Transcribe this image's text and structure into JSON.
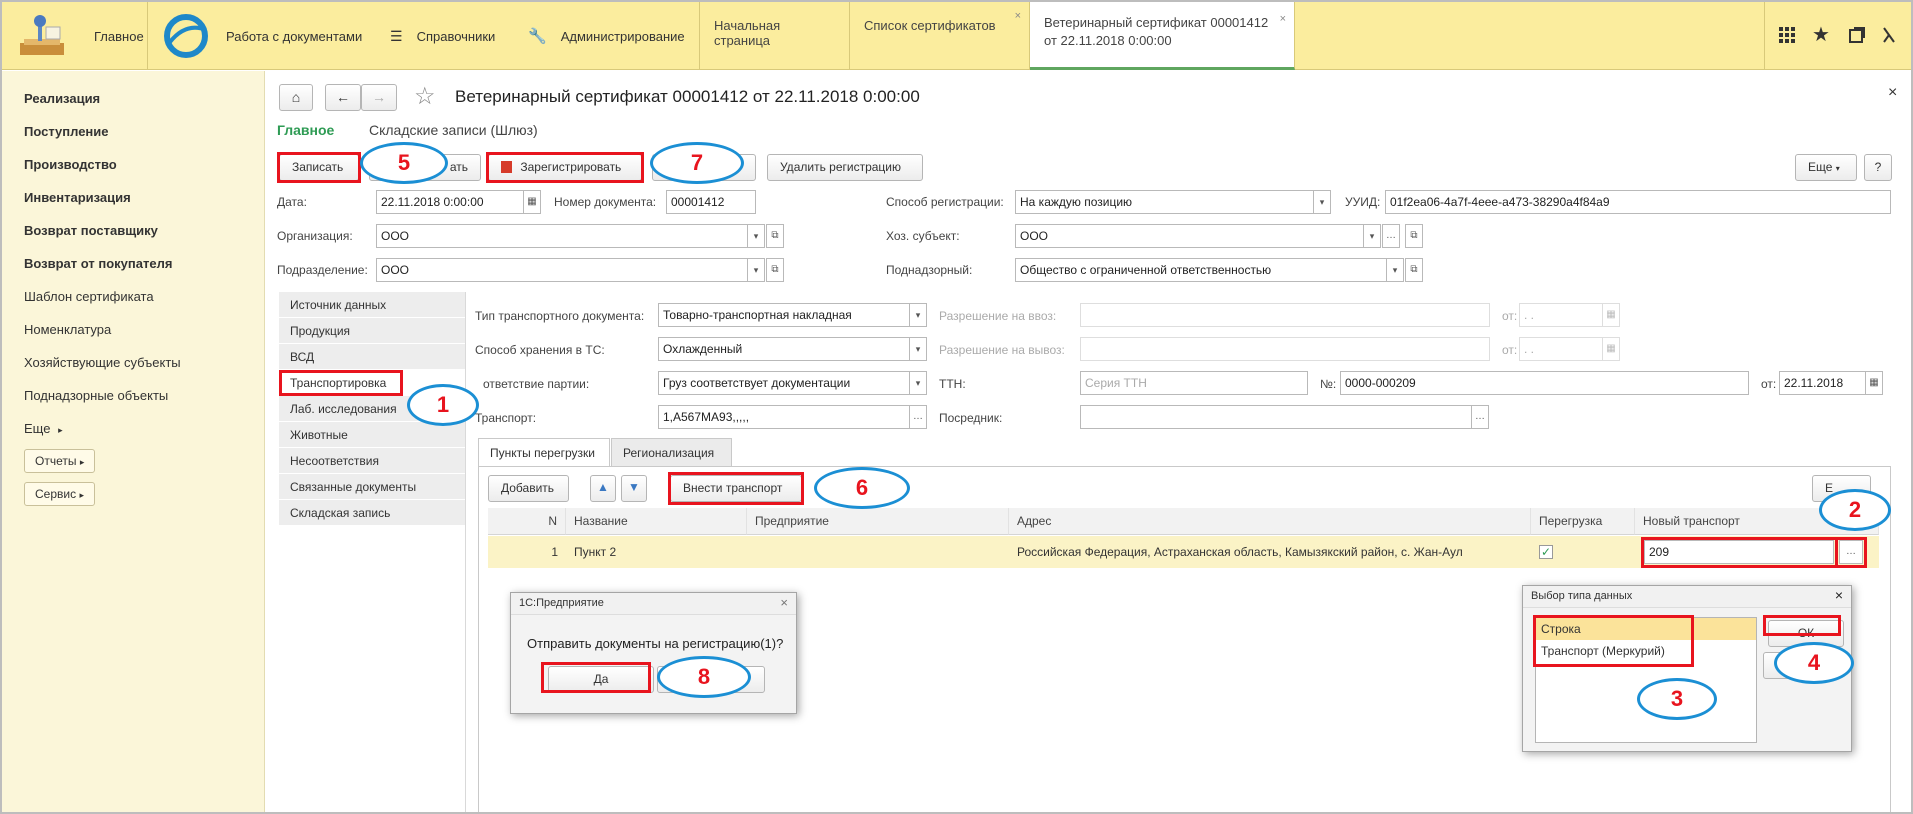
{
  "topbar": {
    "home": "Главное",
    "nav": [
      "Работа с документами",
      "Справочники",
      "Администрирование"
    ],
    "tabs": [
      "Начальная страница",
      "Список сертификатов",
      "Ветеринарный сертификат 00001412 от 22.11.2018 0:00:00"
    ],
    "tab_close": "×"
  },
  "sidebar": {
    "bold_items": [
      "Реализация",
      "Поступление",
      "Производство",
      "Инвентаризация",
      "Возврат поставщику",
      "Возврат от покупателя"
    ],
    "items": [
      "Шаблон сертификата",
      "Номенклатура",
      "Хозяйствующие субъекты",
      "Поднадзорные объекты"
    ],
    "more": "Еще",
    "pills": [
      "Отчеты",
      "Сервис"
    ]
  },
  "header": {
    "title": "Ветеринарный сертификат 00001412 от 22.11.2018 0:00:00",
    "close": "×"
  },
  "sections": {
    "main": "Главное",
    "warehouse": "Складские записи (Шлюз)"
  },
  "toolbar": {
    "save": "Записать",
    "post_partial": "ать",
    "register": "Зарегистрировать",
    "delete_reg": "Удалить регистрацию",
    "more": "Еще",
    "help": "?"
  },
  "form": {
    "date_label": "Дата:",
    "date_value": "22.11.2018  0:00:00",
    "docnum_label": "Номер документа:",
    "docnum_value": "00001412",
    "regmethod_label": "Способ регистрации:",
    "regmethod_value": "На каждую позицию",
    "uuid_label": "УУИД:",
    "uuid_value": "01f2ea06-4a7f-4eee-a473-38290a4f84a9",
    "org_label": "Организация:",
    "org_value": "ООО",
    "subject_label": "Хоз. субъект:",
    "subject_value": "ООО",
    "dept_label": "Подразделение:",
    "dept_value": "ООО",
    "supervised_label": "Поднадзорный:",
    "supervised_value": "Общество с ограниченной ответственностью"
  },
  "vtabs": [
    "Источник данных",
    "Продукция",
    "ВСД",
    "Транспортировка",
    "Лаб. исследования",
    "Животные",
    "Несоответствия",
    "Связанные документы",
    "Складская запись"
  ],
  "transport": {
    "doc_type_label": "Тип транспортного документа:",
    "doc_type_value": "Товарно-транспортная накладная",
    "storage_label": "Способ хранения в ТС:",
    "storage_value": "Охлажденный",
    "conformity_label": "ответствие партии:",
    "conformity_value": "Груз соответствует документации",
    "vehicle_label": "Транспорт:",
    "vehicle_value": "1,А567МА93,,,,,",
    "import_label": "Разрешение на ввоз:",
    "export_label": "Разрешение на вывоз:",
    "from_label": "от:",
    "date_empty": " .  .",
    "ttn_label": "ТТН:",
    "ttn_placeholder": "Серия ТТН",
    "num_label": "№:",
    "num_value": "0000-000209",
    "ttn_date": "22.11.2018",
    "broker_label": "Посредник:"
  },
  "htabs": [
    "Пункты перегрузки",
    "Регионализация"
  ],
  "grid": {
    "add": "Добавить",
    "add_transport": "Внести транспорт",
    "more_partial": "Е",
    "headers": [
      "N",
      "Название",
      "Предприятие",
      "Адрес",
      "Перегрузка",
      "Новый транспорт"
    ],
    "row": {
      "n": "1",
      "name": "Пункт 2",
      "company": "",
      "address": "Российская Федерация, Астраханская область, Камызякский район, с. Жан-Аул",
      "reload": "✓",
      "new_transport": "209"
    }
  },
  "dialog_confirm": {
    "title": "1С:Предприятие",
    "text": "Отправить документы на регистрацию(1)?",
    "yes": "Да"
  },
  "dialog_type": {
    "title": "Выбор типа данных",
    "options": [
      "Строка",
      "Транспорт (Меркурий)"
    ],
    "ok": "ОК"
  },
  "markers": [
    "1",
    "2",
    "3",
    "4",
    "5",
    "6",
    "7",
    "8"
  ],
  "colors": {
    "topbar": "#fbed9e",
    "sidebar": "#fbf6d9",
    "accent_green": "#2e9b54",
    "highlight_red": "#e8141e",
    "bubble_blue": "#1b8fd4",
    "row_selected": "#fbf3c6"
  }
}
